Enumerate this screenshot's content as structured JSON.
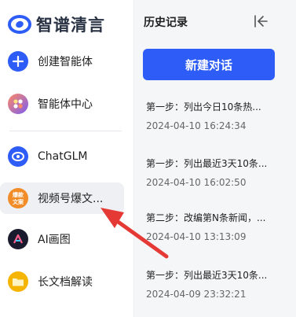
{
  "brand": {
    "name": "智谱清言",
    "accent": "#2d5cf6"
  },
  "nav": [
    {
      "label": "创建智能体",
      "icon": "plus-icon",
      "color": "#2d5cf6"
    },
    {
      "label": "智能体中心",
      "icon": "agents-hub-icon",
      "color": "#7b5cf0"
    },
    {
      "label": "ChatGLM",
      "icon": "chatglm-icon",
      "color": "#2d5cf6"
    },
    {
      "label": "视频号爆文...",
      "icon": "viral-article-agent-icon",
      "color": "#f28c28",
      "badge": "爆款文案",
      "active": true
    },
    {
      "label": "AI画图",
      "icon": "ai-drawing-icon",
      "color": "#1b1b2f"
    },
    {
      "label": "长文档解读",
      "icon": "folder-icon",
      "color": "#f5b400"
    }
  ],
  "history": {
    "title": "历史记录",
    "collapse_icon": "collapse-panel-icon",
    "new_chat_label": "新建对话",
    "items": [
      {
        "title": "第一步：列出今日10条热...",
        "time": "2024-04-10 16:24:34"
      },
      {
        "title": "第一步：列出最近3天10条...",
        "time": "2024-04-10 16:02:50"
      },
      {
        "title": "第二步：改编第N条新闻，...",
        "time": "2024-04-10 13:13:09"
      },
      {
        "title": "第一步：列出最近3天10条...",
        "time": "2024-04-09 23:32:21"
      }
    ]
  },
  "annotation": {
    "type": "red-arrow",
    "color": "#e53935"
  }
}
